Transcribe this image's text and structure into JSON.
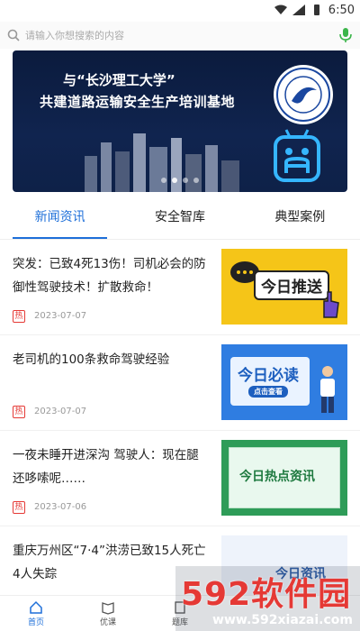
{
  "status": {
    "time": "6:50"
  },
  "search": {
    "placeholder": "请输入你想搜索的内容"
  },
  "banner": {
    "line1": "与“长沙理工大学”",
    "line2": "共建道路运输安全生产培训基地",
    "dots_total": 4,
    "active_dot": 1
  },
  "tabs": [
    {
      "label": "新闻资讯"
    },
    {
      "label": "安全智库"
    },
    {
      "label": "典型案例"
    }
  ],
  "news": [
    {
      "title": "突发：已致4死13伤！司机必会的防御性驾驶技术！扩散救命！",
      "tag": "热",
      "date": "2023-07-07",
      "thumb_text": "今日推送"
    },
    {
      "title": "老司机的100条救命驾驶经验",
      "tag": "热",
      "date": "2023-07-07",
      "thumb_text": "今日必读",
      "thumb_sub": "点击查看"
    },
    {
      "title": "一夜未睡开进深沟 驾驶人：现在腿还哆嗦呢……",
      "tag": "热",
      "date": "2023-07-06",
      "thumb_text": "今日热点资讯"
    },
    {
      "title": "重庆万州区“7·4”洪涝已致15人死亡 4人失踪",
      "thumb_text": "今日资讯"
    }
  ],
  "nav": [
    {
      "label": "首页"
    },
    {
      "label": "优课"
    },
    {
      "label": "题库"
    }
  ],
  "watermark": {
    "big": "592软件园",
    "small": "www.592xiazai.com"
  },
  "colors": {
    "accent": "#1e6fd9",
    "hot": "#e53935",
    "banner_bg": "#0e2148"
  }
}
